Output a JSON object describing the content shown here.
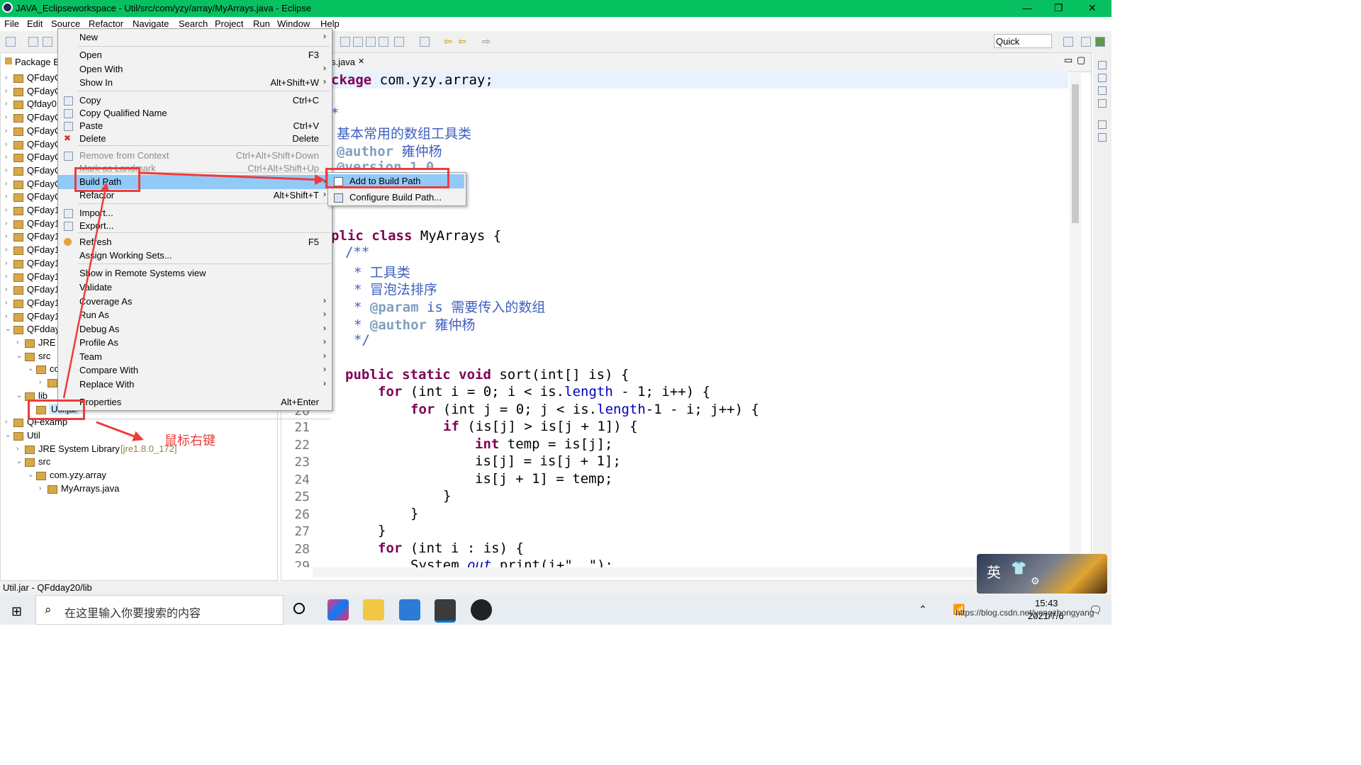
{
  "window": {
    "title": "JAVA_Eclipseworkspace - Util/src/com/yzy/array/MyArrays.java - Eclipse"
  },
  "menubar": [
    "File",
    "Edit",
    "Source",
    "Refactor",
    "Navigate",
    "Search",
    "Project",
    "Run",
    "Window",
    "Help"
  ],
  "toolbar": {
    "quick_access": "Quick Access"
  },
  "package_explorer": {
    "tab_label": "Package E",
    "items": [
      "QFdayC",
      "QFdayC",
      "Qfday0",
      "QFdayC",
      "QFdayC",
      "QFdayC",
      "QFdayC",
      "QFdayC",
      "QFdayC",
      "QFdayC",
      "QFday1",
      "QFday1",
      "QFday1",
      "QFday1",
      "QFday1",
      "QFday1",
      "QFday1",
      "QFday1",
      "QFday1",
      "QFdday",
      "JRE S",
      "src",
      "cc",
      "",
      "lib",
      "Util.jar",
      "QFexamp",
      "Util",
      "JRE System Library",
      "src",
      "com.yzy.array",
      "MyArrays.java"
    ],
    "jre_version": "[jre1.8.0_172]"
  },
  "editor": {
    "tab_label": "s.java",
    "line_numbers": [
      "20",
      "21",
      "22",
      "23",
      "24",
      "25",
      "26",
      "27",
      "28",
      "29"
    ],
    "code": {
      "package_kw": "ckage",
      "package_name": "com.yzy.array;",
      "doc1": "*",
      "doc2_cn": "基本常用的数组工具类",
      "doc3_tag": "@author",
      "doc3_cn": "雍仲杨",
      "doc4": "@version 1.0",
      "class_kw": "plic class",
      "class_name": "MyArrays {",
      "j1": "/**",
      "j2": "* 工具类",
      "j3": "* 冒泡法排序",
      "j4_tag": "@param",
      "j4_name": "is",
      "j4_cn": "需要传入的数组",
      "j5_tag": "@author",
      "j5_cn": "雍仲杨",
      "j6": "*/",
      "m_kw": "public static void",
      "m_rest": "sort(int[] is) {",
      "for1_kw": "for",
      "for1_rest": "(int i = 0; i < is.",
      "for1_fld": "length",
      "for1_tail": "- 1; i++) {",
      "for2_kw": "for",
      "for2_rest": "(int j = 0; j < is.",
      "for2_fld": "length",
      "for2_tail": "-1 - i; j++) {",
      "if_kw": "if",
      "if_rest": "(is[j] > is[j + 1]) {",
      "int_kw": "int",
      "int_rest": "temp = is[j];",
      "l23": "is[j] = is[j + 1];",
      "l24": "is[j + 1] = temp;",
      "l25": "}",
      "l26": "}",
      "l27": "}",
      "l28_kw": "for",
      "l28_rest": "(int i : is) {",
      "l29": "System.",
      "l29_st": "out",
      "l29_tail": ".print(i+\", \");"
    }
  },
  "context_menu": {
    "items": [
      {
        "label": "New",
        "shortcut": "",
        "submenu": true
      },
      {
        "label": "Open",
        "shortcut": "F3"
      },
      {
        "label": "Open With",
        "shortcut": "",
        "submenu": true
      },
      {
        "label": "Show In",
        "shortcut": "Alt+Shift+W",
        "submenu": true
      },
      {
        "label": "Copy",
        "shortcut": "Ctrl+C"
      },
      {
        "label": "Copy Qualified Name",
        "shortcut": ""
      },
      {
        "label": "Paste",
        "shortcut": "Ctrl+V"
      },
      {
        "label": "Delete",
        "shortcut": "Delete"
      },
      {
        "label": "Remove from Context",
        "shortcut": "Ctrl+Alt+Shift+Down"
      },
      {
        "label": "Mark as Landmark",
        "shortcut": "Ctrl+Alt+Shift+Up"
      },
      {
        "label": "Build Path",
        "shortcut": "",
        "submenu": true
      },
      {
        "label": "Refactor",
        "shortcut": "Alt+Shift+T",
        "submenu": true
      },
      {
        "label": "Import...",
        "shortcut": ""
      },
      {
        "label": "Export...",
        "shortcut": ""
      },
      {
        "label": "Refresh",
        "shortcut": "F5"
      },
      {
        "label": "Assign Working Sets...",
        "shortcut": ""
      },
      {
        "label": "Show in Remote Systems view",
        "shortcut": ""
      },
      {
        "label": "Validate",
        "shortcut": ""
      },
      {
        "label": "Coverage As",
        "shortcut": "",
        "submenu": true
      },
      {
        "label": "Run As",
        "shortcut": "",
        "submenu": true
      },
      {
        "label": "Debug As",
        "shortcut": "",
        "submenu": true
      },
      {
        "label": "Profile As",
        "shortcut": "",
        "submenu": true
      },
      {
        "label": "Team",
        "shortcut": "",
        "submenu": true
      },
      {
        "label": "Compare With",
        "shortcut": "",
        "submenu": true
      },
      {
        "label": "Replace With",
        "shortcut": "",
        "submenu": true
      },
      {
        "label": "Properties",
        "shortcut": "Alt+Enter"
      }
    ]
  },
  "submenu": {
    "items": [
      "Add to Build Path",
      "Configure Build Path..."
    ]
  },
  "annotation": {
    "text": "鼠标右键",
    "color": "#ef3b3b"
  },
  "statusbar": {
    "text": "Util.jar - QFdday20/lib"
  },
  "taskbar": {
    "search_placeholder": "在这里输入你要搜索的内容",
    "time": "15:43",
    "date": "2021/7/6",
    "watermark": "https://blog.csdn.net/yongzhongyang",
    "ime": "英"
  },
  "colors": {
    "title_bar": "#07c160",
    "highlight": "#91c9f7",
    "red_box": "#ef3b3b"
  }
}
